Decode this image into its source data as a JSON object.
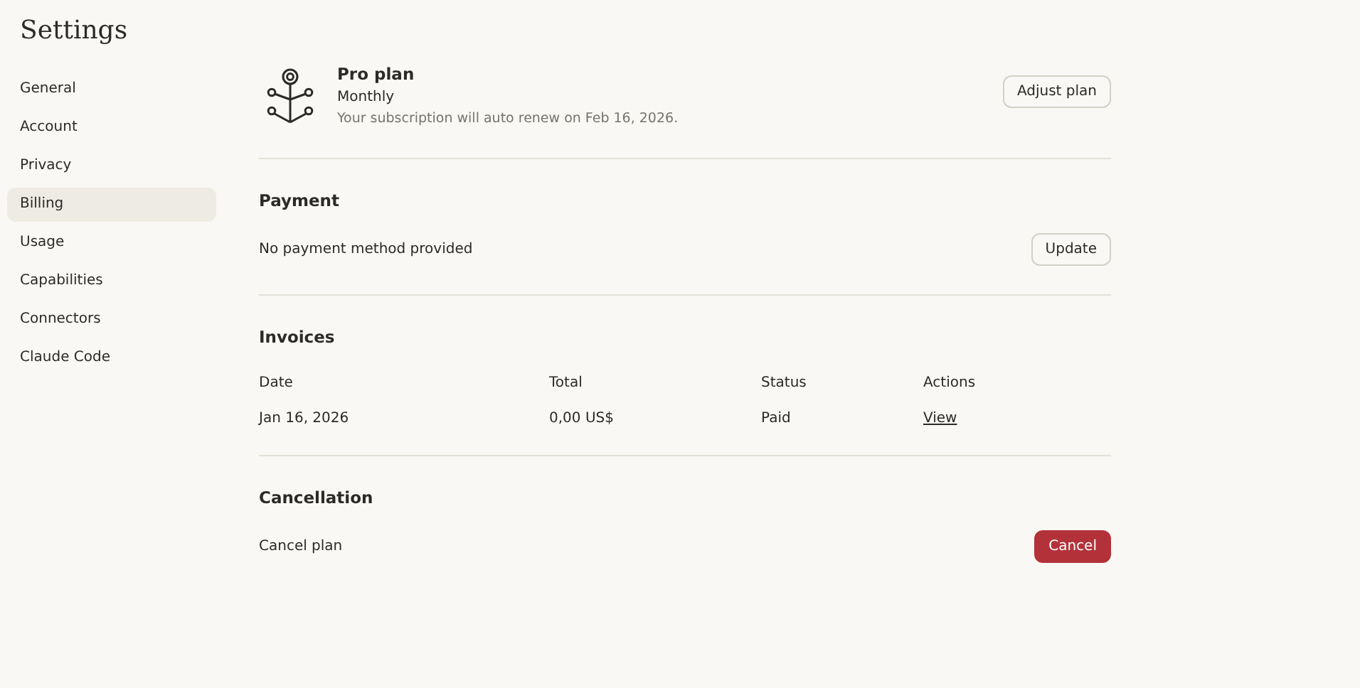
{
  "title": "Settings",
  "sidebar": {
    "items": [
      {
        "label": "General",
        "selected": false
      },
      {
        "label": "Account",
        "selected": false
      },
      {
        "label": "Privacy",
        "selected": false
      },
      {
        "label": "Billing",
        "selected": true
      },
      {
        "label": "Usage",
        "selected": false
      },
      {
        "label": "Capabilities",
        "selected": false
      },
      {
        "label": "Connectors",
        "selected": false
      },
      {
        "label": "Claude Code",
        "selected": false
      }
    ]
  },
  "plan": {
    "name": "Pro plan",
    "period": "Monthly",
    "note": "Your subscription will auto renew on Feb 16, 2026.",
    "button": "Adjust plan"
  },
  "payment": {
    "heading": "Payment",
    "text": "No payment method provided",
    "button": "Update"
  },
  "invoices": {
    "heading": "Invoices",
    "columns": [
      "Date",
      "Total",
      "Status",
      "Actions"
    ],
    "rows": [
      {
        "date": "Jan 16, 2026",
        "total": "0,00 US$",
        "status": "Paid",
        "action": "View"
      }
    ]
  },
  "cancellation": {
    "heading": "Cancellation",
    "text": "Cancel plan",
    "button": "Cancel"
  }
}
